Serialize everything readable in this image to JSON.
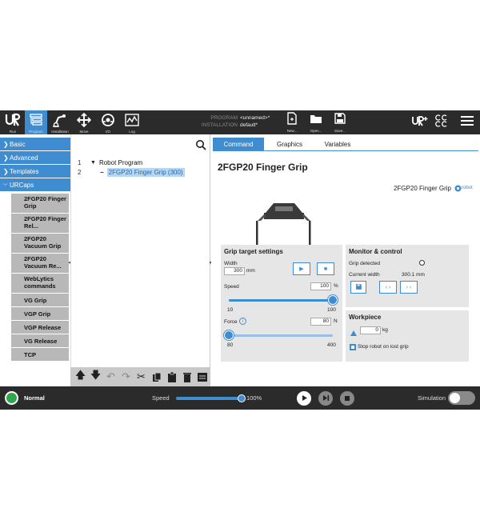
{
  "topbar": {
    "nav": [
      {
        "label": "Run",
        "icon": "ur-logo-icon"
      },
      {
        "label": "Program",
        "icon": "program-icon",
        "active": true
      },
      {
        "label": "Installation",
        "icon": "robot-arm-icon"
      },
      {
        "label": "Move",
        "icon": "move-arrows-icon"
      },
      {
        "label": "I/O",
        "icon": "io-icon"
      },
      {
        "label": "Log",
        "icon": "log-chart-icon"
      }
    ],
    "program_key": "PROGRAM",
    "program_value": "<unnamed>*",
    "installation_key": "INSTALLATION",
    "installation_value": "default*",
    "file_buttons": [
      {
        "label": "New...",
        "icon": "new-file-icon"
      },
      {
        "label": "Open...",
        "icon": "folder-icon"
      },
      {
        "label": "Save...",
        "icon": "save-icon"
      }
    ]
  },
  "sidebar": {
    "categories": [
      {
        "label": "Basic",
        "icon": "chevron-right-icon"
      },
      {
        "label": "Advanced",
        "icon": "chevron-right-icon"
      },
      {
        "label": "Templates",
        "icon": "chevron-right-icon"
      },
      {
        "label": "URCaps",
        "icon": "chevron-down-icon",
        "expanded": true
      }
    ],
    "urcaps_items": [
      "2FGP20 Finger Grip",
      "2FGP20 Finger Rel...",
      "2FGP20 Vacuum Grip",
      "2FGP20 Vacuum Re...",
      "WebLytics commands",
      "VG Grip",
      "VGP Grip",
      "VGP Release",
      "VG Release",
      "TCP"
    ]
  },
  "tree": {
    "rows": [
      {
        "num": "1",
        "label": "Robot Program"
      },
      {
        "num": "2",
        "label": "2FGP20 Finger Grip (300)"
      }
    ],
    "toolbar_icons": [
      "move-up-icon",
      "move-down-icon",
      "undo-icon",
      "redo-icon",
      "cut-icon",
      "copy-icon",
      "paste-icon",
      "delete-icon",
      "suppress-icon"
    ]
  },
  "main": {
    "tabs": [
      "Command",
      "Graphics",
      "Variables"
    ],
    "active_tab": "Command",
    "title": "2FGP20 Finger Grip",
    "brand_text": "2FGP20 Finger Grip",
    "brand_logo": "robot",
    "grip": {
      "heading": "Grip target settings",
      "width_label": "Width",
      "width_value": "300",
      "width_unit": "mm",
      "speed_label": "Speed",
      "speed_value": "100",
      "speed_unit": "%",
      "speed_min": "10",
      "speed_max": "100",
      "speed_fraction": 1.0,
      "force_label": "Force",
      "force_value": "80",
      "force_unit": "N",
      "force_min": "80",
      "force_max": "400",
      "force_fraction": 0.0
    },
    "monitor": {
      "heading": "Monitor & control",
      "grip_detected_label": "Grip detected",
      "current_width_label": "Current width",
      "current_width_value": "300.1 mm"
    },
    "workpiece": {
      "heading": "Workpiece",
      "weight_value": "0",
      "weight_unit": "kg",
      "stop_label": "Stop robot on lost grip"
    }
  },
  "footer": {
    "status": "Normal",
    "status_color": "#2ea84a",
    "speed_label": "Speed",
    "speed_value": "100%",
    "speed_fraction": 1.0,
    "simulation_label": "Simulation"
  },
  "colors": {
    "accent": "#3f8cd1",
    "bar": "#2b2b2b"
  }
}
